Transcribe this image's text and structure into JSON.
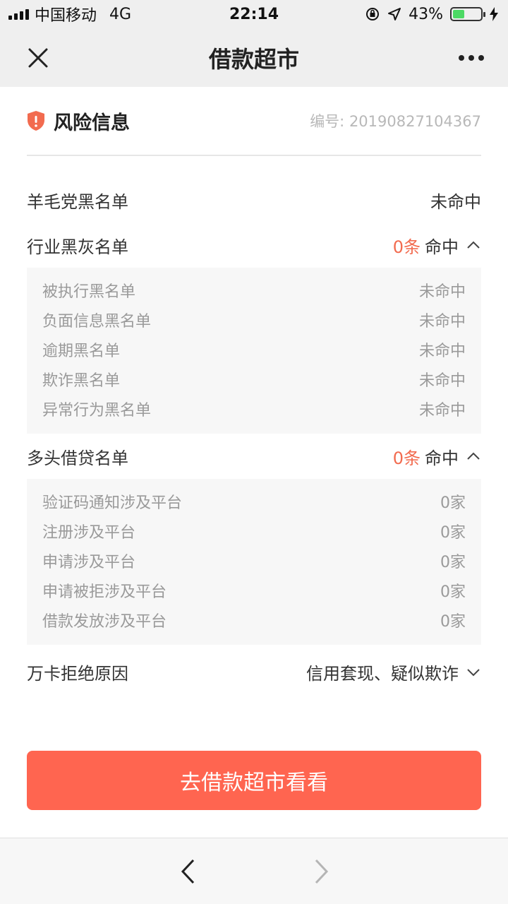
{
  "status_bar": {
    "carrier": "中国移动",
    "network": "4G",
    "time": "22:14",
    "battery_percent": "43%",
    "battery_level": 0.43
  },
  "nav": {
    "title": "借款超市",
    "close_icon": "close-icon",
    "more_icon": "more-dots-icon"
  },
  "risk": {
    "title": "风险信息",
    "ref_no": "编号: 20190827104367",
    "icon": "shield-alert-icon",
    "accent_color": "#f26b4f"
  },
  "rows": {
    "wool": {
      "label": "羊毛党黑名单",
      "value": "未命中"
    },
    "industry": {
      "label": "行业黑灰名单",
      "count": "0条",
      "status": "命中",
      "items": [
        {
          "label": "被执行黑名单",
          "value": "未命中"
        },
        {
          "label": "负面信息黑名单",
          "value": "未命中"
        },
        {
          "label": "逾期黑名单",
          "value": "未命中"
        },
        {
          "label": "欺诈黑名单",
          "value": "未命中"
        },
        {
          "label": "异常行为黑名单",
          "value": "未命中"
        }
      ]
    },
    "multi": {
      "label": "多头借贷名单",
      "count": "0条",
      "status": "命中",
      "items": [
        {
          "label": "验证码通知涉及平台",
          "value": "0家"
        },
        {
          "label": "注册涉及平台",
          "value": "0家"
        },
        {
          "label": "申请涉及平台",
          "value": "0家"
        },
        {
          "label": "申请被拒涉及平台",
          "value": "0家"
        },
        {
          "label": "借款发放涉及平台",
          "value": "0家"
        }
      ]
    },
    "reason": {
      "label": "万卡拒绝原因",
      "value": "信用套现、疑似欺诈"
    }
  },
  "cta": {
    "label": "去借款超市看看",
    "color": "#ff6550"
  }
}
